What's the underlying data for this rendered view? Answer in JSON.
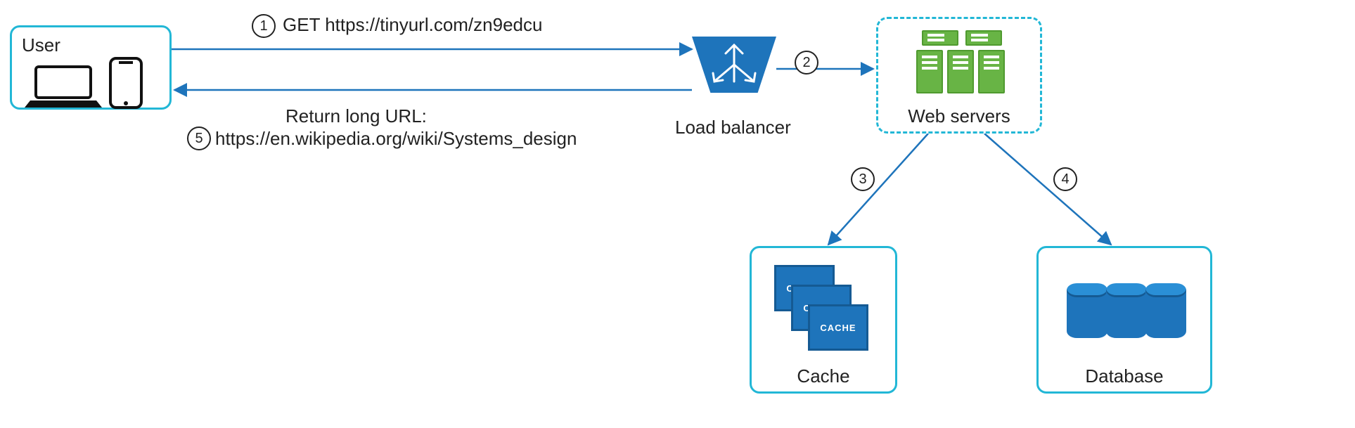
{
  "nodes": {
    "user": {
      "title": "User"
    },
    "load_balancer": {
      "title": "Load balancer"
    },
    "web_servers": {
      "title": "Web servers"
    },
    "cache": {
      "title": "Cache",
      "tile_label": "CACHE"
    },
    "database": {
      "title": "Database"
    }
  },
  "steps": {
    "s1": {
      "num": "1",
      "label": "GET https://tinyurl.com/zn9edcu"
    },
    "s2": {
      "num": "2"
    },
    "s3": {
      "num": "3"
    },
    "s4": {
      "num": "4"
    },
    "s5": {
      "num": "5",
      "label_top": "Return long URL:",
      "label_bottom": "https://en.wikipedia.org/wiki/Systems_design"
    }
  },
  "colors": {
    "border": "#22b7d6",
    "arrow": "#1e74bb",
    "server": "#68b445",
    "block": "#1e74bb"
  }
}
